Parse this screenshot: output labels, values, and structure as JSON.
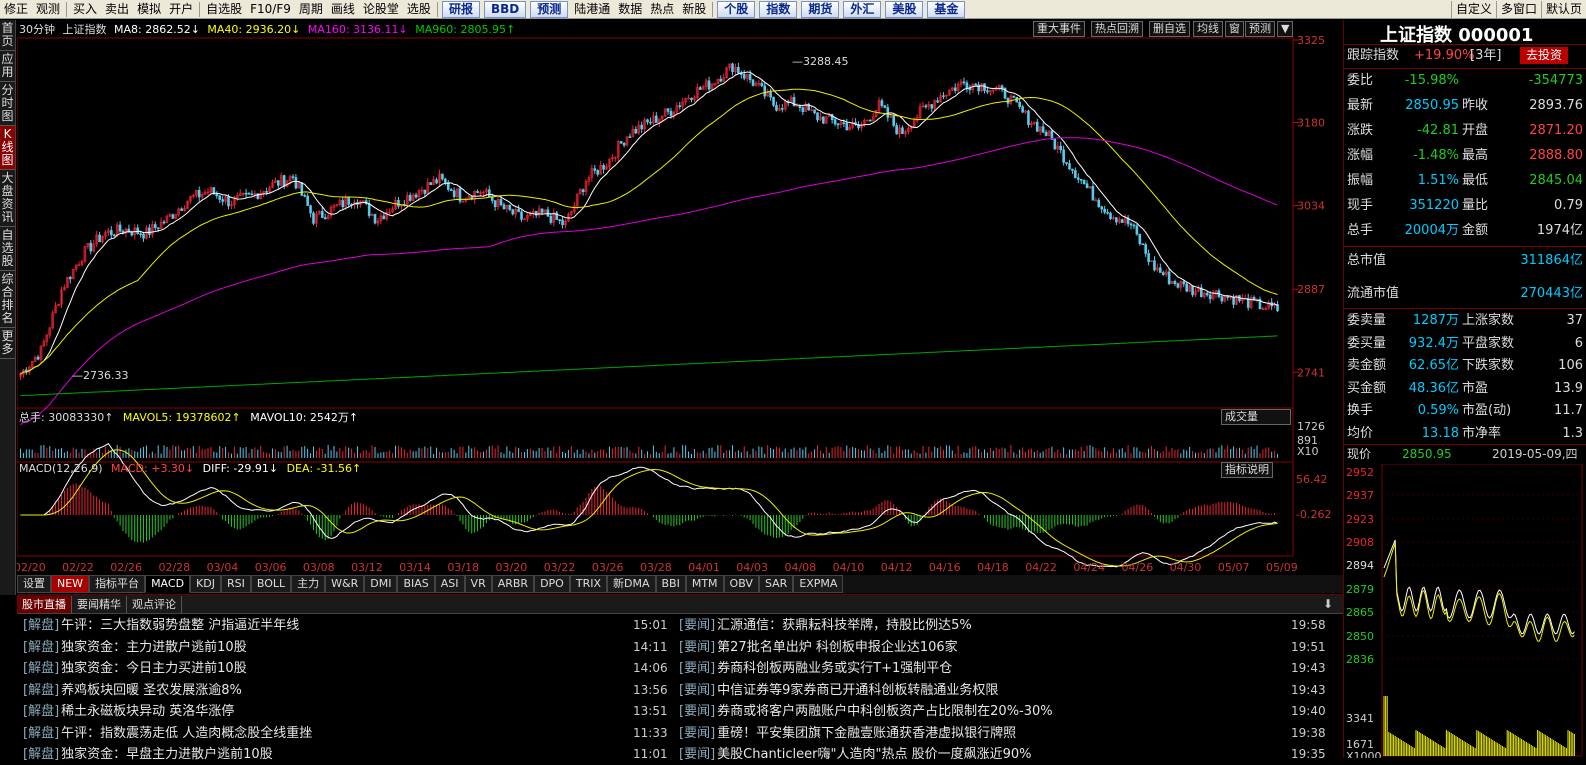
{
  "toolbar": {
    "items": [
      "修正",
      "观测",
      "买入",
      "卖出",
      "模拟",
      "开户",
      "自选股",
      "F10/F9",
      "周期",
      "画线",
      "论股堂",
      "选股"
    ],
    "buttons": [
      "研报",
      "BBD",
      "预测",
      "陆港通",
      "数据",
      "热点",
      "新股",
      "个股",
      "指数",
      "期货",
      "外汇",
      "美股",
      "基金"
    ],
    "buttons_highlight": [
      "研报",
      "BBD",
      "预测",
      "个股",
      "指数",
      "期货",
      "基金",
      "外汇",
      "美股"
    ],
    "right": [
      "自定义",
      "多窗口",
      "默认页"
    ]
  },
  "leftnav": [
    "首页",
    "应用",
    "分时图",
    "K线图",
    "大盘资讯",
    "自选股",
    "综合排名",
    "更多"
  ],
  "chart": {
    "header": {
      "period": "30分钟",
      "name": "上证指数",
      "ma8": "MA8: 2862.52↓",
      "ma40": "MA40: 2936.20↓",
      "ma160": "MA160: 3136.11↓",
      "ma960": "MA960: 2805.95↑"
    },
    "buttons": [
      "重大事件",
      "热点回溯",
      "删自选",
      "均线",
      "窗",
      "预测",
      "▼"
    ],
    "yaxis": [
      "3325",
      "3180",
      "3034",
      "2887",
      "2741"
    ],
    "high_label": "3288.45",
    "low_label": "2736.33",
    "vol": {
      "header_total": "总手: 30083330↑",
      "mavol5": "MAVOL5: 19378602↑",
      "mavol10": "MAVOL10: 2542万↑",
      "axis": [
        "1726",
        "891",
        "X10"
      ],
      "select": "成交量"
    },
    "macd": {
      "header": "MACD(12,26,9)",
      "macd": "MACD: +3.30↓",
      "diff": "DIFF: -29.91↓",
      "dea": "DEA: -31.56↑",
      "axis_top": "56.42",
      "axis_mid": "-0.262",
      "btn": "指标说明"
    },
    "xaxis": [
      "02/20",
      "02/22",
      "02/26",
      "02/28",
      "03/04",
      "03/06",
      "03/08",
      "03/12",
      "03/14",
      "03/18",
      "03/20",
      "03/22",
      "03/26",
      "03/28",
      "04/01",
      "04/03",
      "04/08",
      "04/10",
      "04/12",
      "04/16",
      "04/18",
      "04/22",
      "04/24",
      "04/26",
      "04/30",
      "05/07",
      "05/09"
    ]
  },
  "chart_data": {
    "type": "candlestick",
    "title": "上证指数 30分钟",
    "ylim": [
      2680,
      3325
    ],
    "ma_series": [
      {
        "name": "MA40"
      },
      {
        "name": "MA160"
      },
      {
        "name": "MA960"
      }
    ],
    "close": [
      2738,
      2780,
      2890,
      2950,
      2985,
      2992,
      2985,
      3010,
      3045,
      3060,
      3040,
      3050,
      3070,
      3085,
      3010,
      3030,
      3050,
      3010,
      3040,
      3060,
      3080,
      3050,
      3060,
      3030,
      3010,
      3020,
      3000,
      3080,
      3110,
      3160,
      3180,
      3200,
      3230,
      3250,
      3280,
      3250,
      3210,
      3215,
      3190,
      3180,
      3170,
      3210,
      3160,
      3200,
      3230,
      3250,
      3245,
      3230,
      3190,
      3160,
      3110,
      3060,
      3020,
      3000,
      2930,
      2900,
      2885,
      2880,
      2870,
      2860,
      2851
    ]
  },
  "indicator_tabs": [
    "设置",
    "NEW",
    "指标平台",
    "MACD",
    "KDJ",
    "RSI",
    "BOLL",
    "主力",
    "W&R",
    "DMI",
    "BIAS",
    "ASI",
    "VR",
    "ARBR",
    "DPO",
    "TRIX",
    "新DMA",
    "BBI",
    "MTM",
    "OBV",
    "SAR",
    "EXPMA"
  ],
  "news": {
    "tabs": [
      "股市直播",
      "要闻精华",
      "观点评论"
    ],
    "left": [
      {
        "tag": "[解盘]",
        "title": "午评：三大指数弱势盘整 沪指逼近半年线",
        "time": "15:01"
      },
      {
        "tag": "[解盘]",
        "title": "独家资金：主力进散户逃前10股",
        "time": "14:11"
      },
      {
        "tag": "[解盘]",
        "title": "独家资金：今日主力买进前10股",
        "time": "14:06"
      },
      {
        "tag": "[解盘]",
        "title": "养鸡板块回暖 圣农发展涨逾8%",
        "time": "13:56"
      },
      {
        "tag": "[解盘]",
        "title": "稀土永磁板块异动 英洛华涨停",
        "time": "13:51"
      },
      {
        "tag": "[解盘]",
        "title": "午评：指数震荡走低 人造肉概念股全线重挫",
        "time": "11:33"
      },
      {
        "tag": "[解盘]",
        "title": "独家资金：早盘主力进散户逃前10股",
        "time": "11:01"
      }
    ],
    "right": [
      {
        "tag": "[要闻]",
        "title": "汇源通信：获鼎耘科技举牌，持股比例达5%",
        "time": "19:58"
      },
      {
        "tag": "[要闻]",
        "title": "第27批名单出炉 科创板申报企业达106家",
        "time": "19:51"
      },
      {
        "tag": "[要闻]",
        "title": "券商科创板两融业务或实行T+1强制平仓",
        "time": "19:43"
      },
      {
        "tag": "[要闻]",
        "title": "中信证券等9家券商已开通科创板转融通业务权限",
        "time": "19:43"
      },
      {
        "tag": "[要闻]",
        "title": "券商或将客户两融账户中科创板资产占比限制在20%-30%",
        "time": "19:40"
      },
      {
        "tag": "[要闻]",
        "title": "重磅！平安集团旗下金融壹账通获香港虚拟银行牌照",
        "time": "19:38"
      },
      {
        "tag": "[要闻]",
        "title": "美股Chanticleer嗨\"人造肉\"热点 股价一度飙涨近90%",
        "time": "19:35"
      }
    ]
  },
  "right": {
    "title": "上证指数 000001",
    "track": {
      "label": "跟踪指数",
      "value": "+19.90%",
      "period": "[3年]",
      "btn": "去投资"
    },
    "rows1": [
      {
        "l": "委比",
        "v": "-15.98%",
        "l2": "",
        "v2": "-354773"
      },
      {
        "l": "最新",
        "v": "2850.95",
        "l2": "昨收",
        "v2": "2893.76"
      },
      {
        "l": "涨跌",
        "v": "-42.81",
        "l2": "开盘",
        "v2": "2871.20"
      },
      {
        "l": "涨幅",
        "v": "-1.48%",
        "l2": "最高",
        "v2": "2888.80"
      },
      {
        "l": "振幅",
        "v": "1.51%",
        "l2": "最低",
        "v2": "2845.04"
      },
      {
        "l": "现手",
        "v": "351220",
        "l2": "量比",
        "v2": "0.79"
      },
      {
        "l": "总手",
        "v": "20004万",
        "l2": "金额",
        "v2": "1974亿"
      }
    ],
    "rows2": [
      {
        "l": "总市值",
        "v": "311864亿"
      },
      {
        "l": "流通市值",
        "v": "270443亿"
      }
    ],
    "rows3": [
      {
        "l": "委卖量",
        "v": "1287万",
        "l2": "上涨家数",
        "v2": "37"
      },
      {
        "l": "委买量",
        "v": "932.4万",
        "l2": "平盘家数",
        "v2": "6"
      },
      {
        "l": "卖金额",
        "v": "62.65亿",
        "l2": "下跌家数",
        "v2": "106"
      },
      {
        "l": "买金额",
        "v": "48.36亿",
        "l2": "市盈",
        "v2": "13.9"
      },
      {
        "l": "换手",
        "v": "0.59%",
        "l2": "市盈(动)",
        "v2": "11.7"
      },
      {
        "l": "均价",
        "v": "13.18",
        "l2": "市净率",
        "v2": "1.3"
      }
    ],
    "mini": {
      "now_label": "现价",
      "now": "2850.95",
      "date": "2019-05-09,四",
      "axis": [
        "2952",
        "2937",
        "2923",
        "2908",
        "2894",
        "2879",
        "2865",
        "2850",
        "2836",
        "3341",
        "1671",
        "X1000"
      ]
    }
  }
}
